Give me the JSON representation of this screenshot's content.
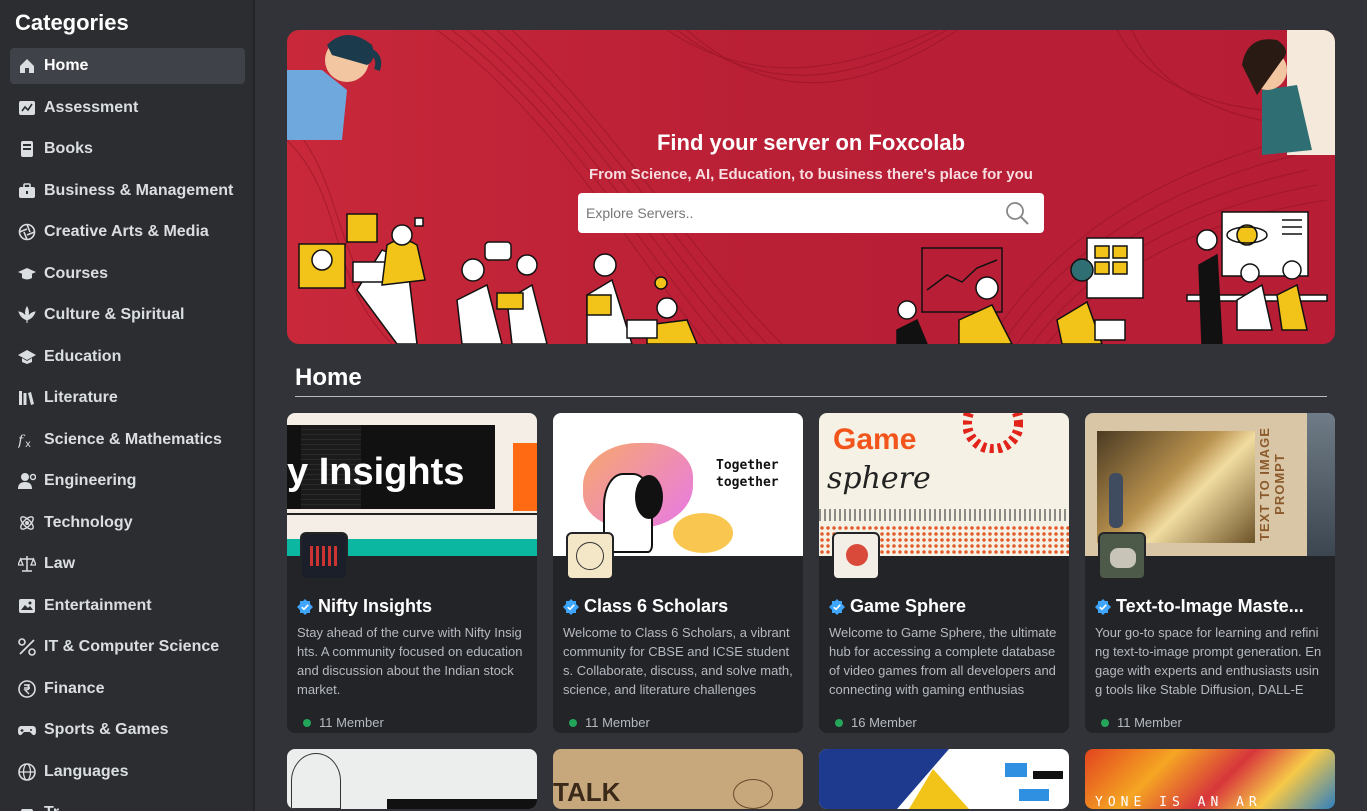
{
  "sidebar": {
    "title": "Categories",
    "items": [
      {
        "label": "Home",
        "icon": "home-icon",
        "active": true
      },
      {
        "label": "Assessment",
        "icon": "assessment-icon"
      },
      {
        "label": "Books",
        "icon": "book-icon"
      },
      {
        "label": "Business & Management",
        "icon": "briefcase-icon"
      },
      {
        "label": "Creative Arts & Media",
        "icon": "aperture-icon"
      },
      {
        "label": "Courses",
        "icon": "graduation-cap-icon"
      },
      {
        "label": "Culture & Spiritual",
        "icon": "leaf-icon"
      },
      {
        "label": "Education",
        "icon": "school-cap-icon"
      },
      {
        "label": "Literature",
        "icon": "library-icon"
      },
      {
        "label": "Science & Mathematics",
        "icon": "function-icon"
      },
      {
        "label": "Engineering",
        "icon": "engineer-icon"
      },
      {
        "label": "Technology",
        "icon": "atom-icon"
      },
      {
        "label": "Law",
        "icon": "scales-icon"
      },
      {
        "label": "Entertainment",
        "icon": "image-icon"
      },
      {
        "label": "IT & Computer Science",
        "icon": "tools-icon"
      },
      {
        "label": "Finance",
        "icon": "rupee-icon"
      },
      {
        "label": "Sports & Games",
        "icon": "gamepad-icon"
      },
      {
        "label": "Languages",
        "icon": "globe-icon"
      },
      {
        "label": "Tr...",
        "icon": "travel-icon"
      }
    ]
  },
  "banner": {
    "title": "Find your server on Foxcolab",
    "subtitle": "From Science, AI, Education, to business there's place for you",
    "search_placeholder": "Explore Servers..",
    "colors": {
      "background": "#c0243a",
      "accent": "#f2c318"
    }
  },
  "section": {
    "title": "Home"
  },
  "servers": [
    {
      "name": "Nifty Insights",
      "banner_text": "y Insights",
      "description": "Stay ahead of the curve with Nifty Insights. A community focused on education and discussion about the Indian stock market.",
      "members": "11 Member",
      "verified": true
    },
    {
      "name": "Class 6 Scholars",
      "banner_text": "Together together",
      "description": "Welcome to Class 6 Scholars, a vibrant community for CBSE and ICSE students. Collaborate, discuss, and solve math, science, and literature challenges",
      "members": "11 Member",
      "verified": true
    },
    {
      "name": "Game Sphere",
      "banner_text": "Game",
      "banner_text2": "sphere",
      "description": "Welcome to Game Sphere, the ultimate hub for accessing a complete database of video games from all developers and connecting with gaming enthusias",
      "members": "16 Member",
      "verified": true
    },
    {
      "name": "Text-to-Image Maste...",
      "banner_text": "TEXT TO IMAGE PROMPT",
      "description": "Your go-to space for learning and refining text-to-image prompt generation. Engage with experts and enthusiasts using tools like Stable Diffusion, DALL-E",
      "members": "11 Member",
      "verified": true
    }
  ],
  "row2": [
    {
      "banner_text": ""
    },
    {
      "banner_text": "TALK"
    },
    {
      "banner_text": ""
    },
    {
      "banner_text": "YONE IS AN AR"
    }
  ]
}
